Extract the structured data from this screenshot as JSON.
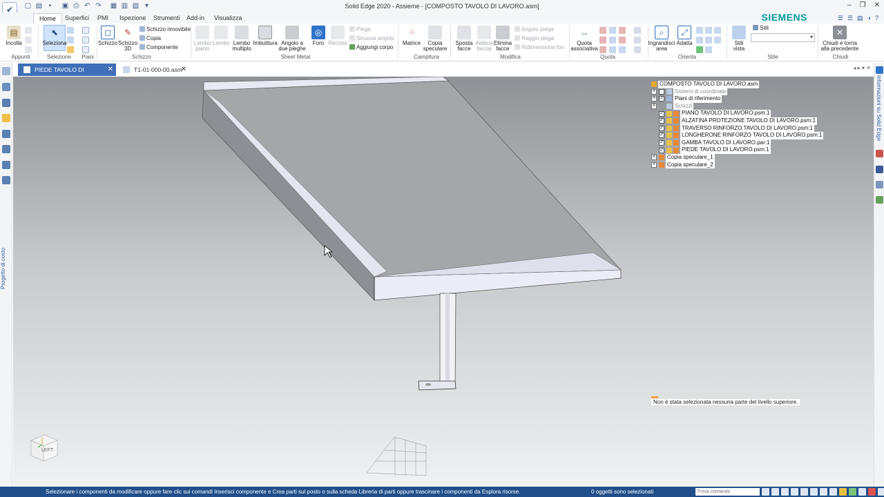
{
  "window": {
    "title": "Solid Edge 2020 - Assieme - [COMPOSTO TAVOLO DI LAVORO.asm]",
    "brand": "SIEMENS",
    "controls": [
      "–",
      "❐",
      "✕"
    ]
  },
  "ribbon_tabs": [
    "Home",
    "Superfici",
    "PMI",
    "Ispezione",
    "Strumenti",
    "Add-in",
    "Visualizza"
  ],
  "ribbon": {
    "incolla": "Incolla",
    "seleziona": "Seleziona",
    "schizzo": "Schizzo",
    "schizzo3d": "Schizzo 3D",
    "schizzo_rimovibile": "Schizzo rimovibile",
    "copia": "Copia",
    "componente": "Componente",
    "lembo_piano": "Lembo piano",
    "lembo": "Lembo",
    "lembo_multiplo": "Lembo multiplo",
    "imbutitura": "Imbutitura",
    "angolo_due_pieghe": "Angolo a due pieghe",
    "foro": "Foro",
    "recinto": "Recinto",
    "piega": "Piega",
    "sinusia_angolo": "Sinussa angolo",
    "aggiungi_corpo": "Aggiungi corpo",
    "matrice": "Matrice",
    "copia_speculare": "Copia speculare",
    "sposta_facce": "Sposta facce",
    "abbina_faccia": "Abbina faccia",
    "elimina_facce": "Elimina facce",
    "angolo_piega": "Angolo piega",
    "raggio_piega": "Raggio piega",
    "ridimensiona_fori": "Ridimensiona fori",
    "quota_associativa": "Quota associativa",
    "ingrandisci_area": "Ingrandisci area",
    "adatta": "Adatta",
    "stili_vista": "Stili vista",
    "stili": "Stili",
    "chiudi": "Chiudi e torna alla precedente"
  },
  "ribbon_groups": [
    "Appunti",
    "Selezione",
    "Piani",
    "Schizzo",
    "Sheet Metal",
    "Campitura",
    "Modifica",
    "Quota",
    "Orienta",
    "Stile",
    "Chiudi"
  ],
  "document_tabs": [
    {
      "label": "PIEDE TAVOLO DI LAVORO....",
      "active": true
    },
    {
      "label": "T1-01-000-00.asm",
      "active": false
    }
  ],
  "left_panel_label": "Progetto di costo",
  "right_panel_label": "Informazioni su Solid Edge",
  "pathfinder": {
    "root": "COMPOSTO TAVOLO DI LAVORO.asm",
    "items": [
      {
        "label": "Sistemi di coordinate",
        "dim": true
      },
      {
        "label": "Piani di riferimento",
        "dim": false
      },
      {
        "label": "Schizzi",
        "dim": true
      },
      {
        "label": "PIANO TAVOLO DI LAVORO.psm:1",
        "dim": false
      },
      {
        "label": "ALZATINA PROTEZIONE TAVOLO DI LAVORO.psm:1",
        "dim": false
      },
      {
        "label": "TRAVERSO RINFORZO TAVOLO DI LAVORO.psm:1",
        "dim": false
      },
      {
        "label": "LONGHERONE RINFORZO TAVOLO DI LAVORO.psm:1",
        "dim": false
      },
      {
        "label": "GAMBA TAVOLO DI LAVORO.par:1",
        "dim": false
      },
      {
        "label": "PIEDE TAVOLO DI LAVORO.psm:1",
        "dim": false
      },
      {
        "label": "Copia speculare_1",
        "dim": false
      },
      {
        "label": "Copia speculare_2",
        "dim": false
      }
    ]
  },
  "viewport_message": "Non è stata selezionata nessuna parte del livello superiore.",
  "view_cube_label": "LEFT",
  "statusbar": {
    "prompt": "Selezionare i componenti da modificare oppure fare clic sui comandi Inserisci componente e Crea parti sul posto o sulla scheda Libreria di parti oppure trascinare i componenti da Esplora risorse.",
    "selection_count": "0 oggetti sono selezionati",
    "command_placeholder": "Trova comando"
  },
  "colors": {
    "statusbar": "#1f4e8a",
    "active_tab": "#3f6fb8",
    "brand": "#009999"
  }
}
